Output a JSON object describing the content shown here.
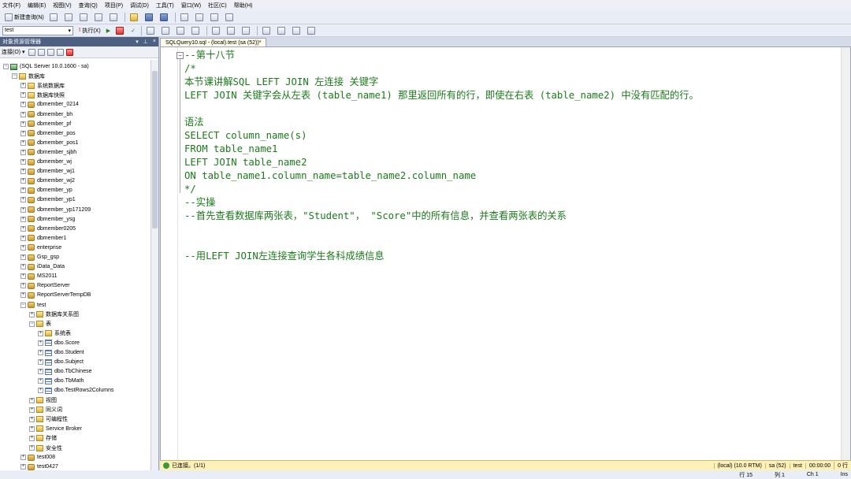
{
  "menu": [
    "文件(F)",
    "编辑(E)",
    "视图(V)",
    "查询(Q)",
    "项目(P)",
    "调试(D)",
    "工具(T)",
    "窗口(W)",
    "社区(C)",
    "帮助(H)"
  ],
  "toolbar1": {
    "new_query": "新建查询(N)"
  },
  "toolbar2": {
    "database": "test",
    "execute": "执行(X)"
  },
  "explorer": {
    "title": "对象资源管理器",
    "connect_label": "连接(O) ▾",
    "server_node": "(SQL Server 10.0.1600 - sa)",
    "databases_label": "数据库",
    "items": [
      "系统数据库",
      "数据库快照",
      "dbmember_0214",
      "dbmember_bh",
      "dbmember_pf",
      "dbmember_pos",
      "dbmember_pos1",
      "dbmember_sjbh",
      "dbmember_wj",
      "dbmember_wj1",
      "dbmember_wj2",
      "dbmember_yp",
      "dbmember_yp1",
      "dbmember_yp171209",
      "dbmember_ysg",
      "dbmember0205",
      "dbmember1",
      "enterprise",
      "Gsp_gsp",
      "iData_Data",
      "MS2011",
      "ReportServer",
      "ReportServerTempDB",
      "test"
    ],
    "test_children": [
      "数据库关系图",
      "表"
    ],
    "tables": [
      "系统表",
      "dbo.Score",
      "dbo.Student",
      "dbo.Subject",
      "dbo.TbChinese",
      "dbo.TbMath",
      "dbo.TestRows2Columns"
    ],
    "test_rest": [
      "视图",
      "同义词",
      "可编程性",
      "Service Broker",
      "存储",
      "安全性"
    ],
    "tail": [
      "test008",
      "test0427"
    ]
  },
  "editor": {
    "tab_title": "SQLQuery10.sql - (local).test (sa (52))*",
    "lines": [
      "--第十八节",
      "/*",
      "本节课讲解SQL LEFT JOIN 左连接 关键字",
      "LEFT JOIN 关键字会从左表 (table_name1) 那里返回所有的行，即使在右表 (table_name2) 中没有匹配的行。",
      "",
      "语法",
      "SELECT column_name(s)",
      "FROM table_name1",
      "LEFT JOIN table_name2",
      "ON table_name1.column_name=table_name2.column_name",
      "*/",
      "--实操",
      "--首先查看数据库两张表，\"Student\"， \"Score\"中的所有信息，并查看两张表的关系",
      "",
      "",
      "--用LEFT JOIN左连接查询学生各科成绩信息"
    ]
  },
  "status": {
    "connected": "已连接。(1/1)",
    "server": "(local) (10.0 RTM)",
    "user": "sa (52)",
    "db": "test",
    "time": "00:00:00",
    "rows": "0 行"
  },
  "status2": {
    "row": "行 15",
    "col": "列 1",
    "ch": "Ch 1",
    "mode": "Ins"
  }
}
